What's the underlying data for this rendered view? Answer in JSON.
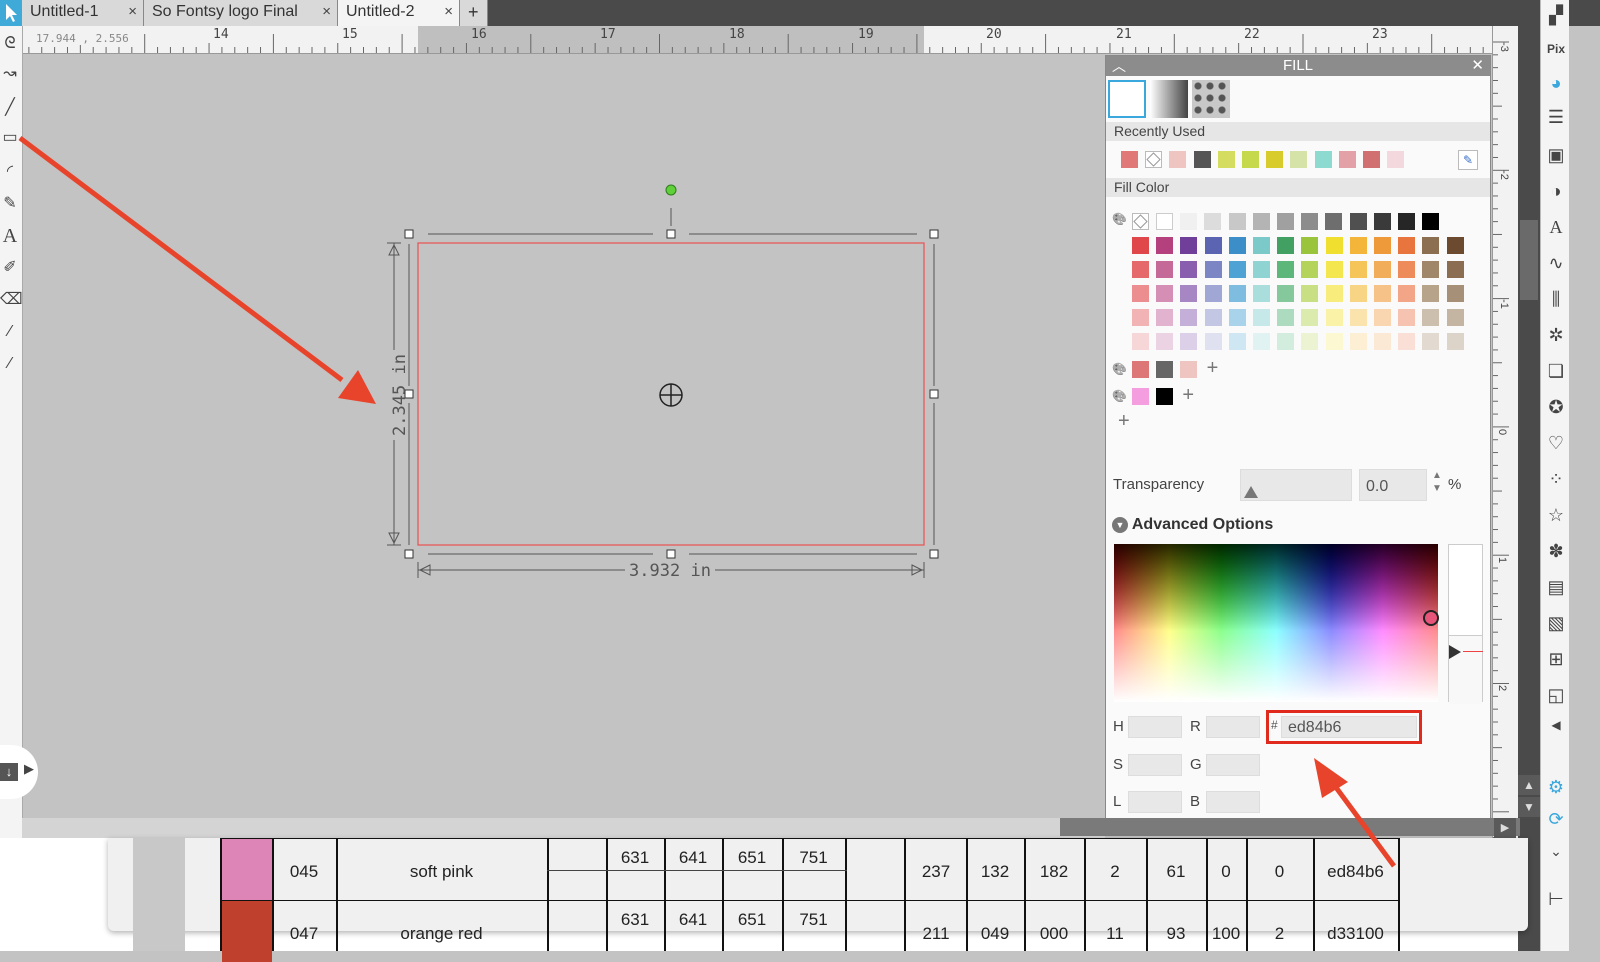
{
  "tabs": [
    {
      "label": "Untitled-1"
    },
    {
      "label": "So Fontsy logo Final"
    },
    {
      "label": "Untitled-2"
    }
  ],
  "ruler": {
    "coords": "17.944 , 2.556",
    "labels": [
      "14",
      "15",
      "16",
      "17",
      "18",
      "19",
      "20",
      "21",
      "22",
      "23"
    ],
    "v_labels": [
      "-3",
      "-2",
      "-1",
      "0",
      "1",
      "2"
    ]
  },
  "shape": {
    "height_label": "2.345 in",
    "width_label": "3.932 in"
  },
  "fill_panel": {
    "title": "FILL",
    "recently_used_label": "Recently Used",
    "recently_used": [
      "#e07878",
      "none",
      "#eec5c0",
      "#555555",
      "#d5dd60",
      "#c6d84c",
      "#d8cc2c",
      "#d6e3a8",
      "#8ddbd0",
      "#e3a0a6",
      "#d07070",
      "#f3d8de"
    ],
    "fill_color_label": "Fill Color",
    "gray_row": [
      "#ffffff",
      "#f0f0f0",
      "#dcdcdc",
      "#c8c8c8",
      "#b4b4b4",
      "#a0a0a0",
      "#8c8c8c",
      "#6e6e6e",
      "#505050",
      "#3a3a3a",
      "#262626",
      "#000000"
    ],
    "palette_rows": [
      [
        "#e0474a",
        "#b5407e",
        "#6f3f9a",
        "#5a64b0",
        "#3c8ec8",
        "#7cc9c9",
        "#43a063",
        "#9ac43c",
        "#f0df2e",
        "#f3b63a",
        "#ee9a3a",
        "#e8743e",
        "#8b6f50",
        "#6b4a30"
      ],
      [
        "#e5686a",
        "#c56a98",
        "#8a5eaf",
        "#7c86c4",
        "#4fa2d4",
        "#8fd3d2",
        "#5db67a",
        "#b3d35a",
        "#f4e64f",
        "#f5c559",
        "#f2ad5b",
        "#ed8b5b",
        "#a18769",
        "#8b6d51"
      ],
      [
        "#ec8d8f",
        "#d58eb4",
        "#a687c4",
        "#a0a7d4",
        "#7fbde0",
        "#a9dedd",
        "#84c89b",
        "#c8df84",
        "#f7ec7c",
        "#f8d585",
        "#f6c288",
        "#f2a687",
        "#b7a28a",
        "#a79078"
      ],
      [
        "#f2b3b4",
        "#e2b3cf",
        "#c4afd8",
        "#c3c7e4",
        "#a9d3eb",
        "#c6e8e8",
        "#addbbf",
        "#dbeaad",
        "#faf2a6",
        "#fae3ad",
        "#f9d6b0",
        "#f6c3b0",
        "#cdbfae",
        "#c4b5a3"
      ],
      [
        "#f7d6d7",
        "#ecd3e3",
        "#dccfe8",
        "#dfe1f0",
        "#cfe6f3",
        "#e1f2f2",
        "#d2ecdd",
        "#ebf3d3",
        "#fcf8d1",
        "#fcefd4",
        "#fbe8d5",
        "#f9dfd5",
        "#e2dad0",
        "#dcd4c9"
      ]
    ],
    "custom_row1": [
      "#dd7777",
      "#666666",
      "#eec5c0"
    ],
    "custom_row2": [
      "#f49ddf",
      "#000000"
    ],
    "transparency_label": "Transparency",
    "transparency_value": "0.0",
    "percent": "%",
    "advanced_label": "Advanced Options",
    "hsl_labels": {
      "h": "H",
      "s": "S",
      "l": "L",
      "r": "R",
      "g": "G",
      "b": "B"
    },
    "hex_prefix": "#",
    "hex_value": "ed84b6"
  },
  "table": {
    "rows": [
      {
        "swatch": "#de85b8",
        "code": "045",
        "name": "soft pink",
        "p1": "631",
        "p2": "641",
        "p3": "651",
        "p4": "751",
        "r": "237",
        "g": "132",
        "b": "182",
        "c": "2",
        "m": "61",
        "y": "0",
        "k": "0",
        "hex": "ed84b6"
      },
      {
        "swatch": "#c0402e",
        "code": "047",
        "name": "orange red",
        "p1": "631",
        "p2": "641",
        "p3": "651",
        "p4": "751",
        "r": "211",
        "g": "049",
        "b": "000",
        "c": "11",
        "m": "93",
        "y": "100",
        "k": "2",
        "hex": "d33100"
      }
    ]
  },
  "colors": {
    "arrow": "#e8442c",
    "selection": "#e85050",
    "hex_highlight": "#e02a1e"
  }
}
